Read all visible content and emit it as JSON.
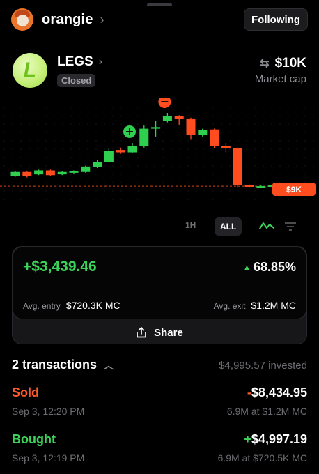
{
  "header": {
    "username": "orangie",
    "follow_label": "Following"
  },
  "token": {
    "name": "LEGS",
    "logo_letter": "L",
    "status": "Closed",
    "market_cap": "$10K",
    "market_cap_label": "Market cap"
  },
  "chart_data": {
    "type": "candlestick",
    "candles": [
      {
        "o": 0.2,
        "c": 0.25,
        "h": 0.26,
        "l": 0.19
      },
      {
        "o": 0.25,
        "c": 0.2,
        "h": 0.26,
        "l": 0.18
      },
      {
        "o": 0.22,
        "c": 0.27,
        "h": 0.28,
        "l": 0.21
      },
      {
        "o": 0.27,
        "c": 0.21,
        "h": 0.28,
        "l": 0.2
      },
      {
        "o": 0.22,
        "c": 0.25,
        "h": 0.26,
        "l": 0.21
      },
      {
        "o": 0.24,
        "c": 0.26,
        "h": 0.27,
        "l": 0.23
      },
      {
        "o": 0.25,
        "c": 0.32,
        "h": 0.33,
        "l": 0.24
      },
      {
        "o": 0.31,
        "c": 0.38,
        "h": 0.4,
        "l": 0.3
      },
      {
        "o": 0.38,
        "c": 0.52,
        "h": 0.55,
        "l": 0.37
      },
      {
        "o": 0.53,
        "c": 0.5,
        "h": 0.56,
        "l": 0.48
      },
      {
        "o": 0.5,
        "c": 0.58,
        "h": 0.62,
        "l": 0.49
      },
      {
        "o": 0.58,
        "c": 0.8,
        "h": 0.84,
        "l": 0.56
      },
      {
        "o": 0.8,
        "c": 0.82,
        "h": 0.9,
        "l": 0.7
      },
      {
        "o": 0.9,
        "c": 0.96,
        "h": 1.0,
        "l": 0.88
      },
      {
        "o": 0.96,
        "c": 0.92,
        "h": 0.97,
        "l": 0.85
      },
      {
        "o": 0.93,
        "c": 0.72,
        "h": 0.94,
        "l": 0.66
      },
      {
        "o": 0.72,
        "c": 0.78,
        "h": 0.8,
        "l": 0.7
      },
      {
        "o": 0.79,
        "c": 0.58,
        "h": 0.8,
        "l": 0.55
      },
      {
        "o": 0.58,
        "c": 0.55,
        "h": 0.62,
        "l": 0.5
      },
      {
        "o": 0.55,
        "c": 0.08,
        "h": 0.56,
        "l": 0.06
      },
      {
        "o": 0.08,
        "c": 0.07,
        "h": 0.09,
        "l": 0.06
      },
      {
        "o": 0.07,
        "c": 0.07,
        "h": 0.08,
        "l": 0.06
      },
      {
        "o": 0.07,
        "c": 0.08,
        "h": 0.09,
        "l": 0.06
      },
      {
        "o": 0.08,
        "c": 0.07,
        "h": 0.09,
        "l": 0.06
      }
    ],
    "buy_candle_index": 10,
    "sell_candle_index": 13,
    "current_price_label": "$9K",
    "up_color": "#2fcf4f",
    "down_color": "#ff4d1f"
  },
  "chart_controls": {
    "range_1h": "1H",
    "range_all": "ALL"
  },
  "pnl": {
    "value": "+$3,439.46",
    "percent": "68.85%",
    "avg_entry_label": "Avg. entry",
    "avg_entry_value": "$720.3K MC",
    "avg_exit_label": "Avg. exit",
    "avg_exit_value": "$1.2M MC",
    "share_label": "Share"
  },
  "transactions": {
    "title": "2 transactions",
    "invested": "$4,995.57 invested",
    "items": [
      {
        "type": "Sold",
        "sign": "-",
        "amount": "$8,434.95",
        "date": "Sep 3, 12:20 PM",
        "detail": "6.9M at $1.2M MC"
      },
      {
        "type": "Bought",
        "sign": "+",
        "amount": "$4,997.19",
        "date": "Sep 3, 12:19 PM",
        "detail": "6.9M at $720.5K MC"
      }
    ]
  },
  "colors": {
    "green": "#3bd45a",
    "red": "#ff5a2b",
    "background": "#000000"
  }
}
